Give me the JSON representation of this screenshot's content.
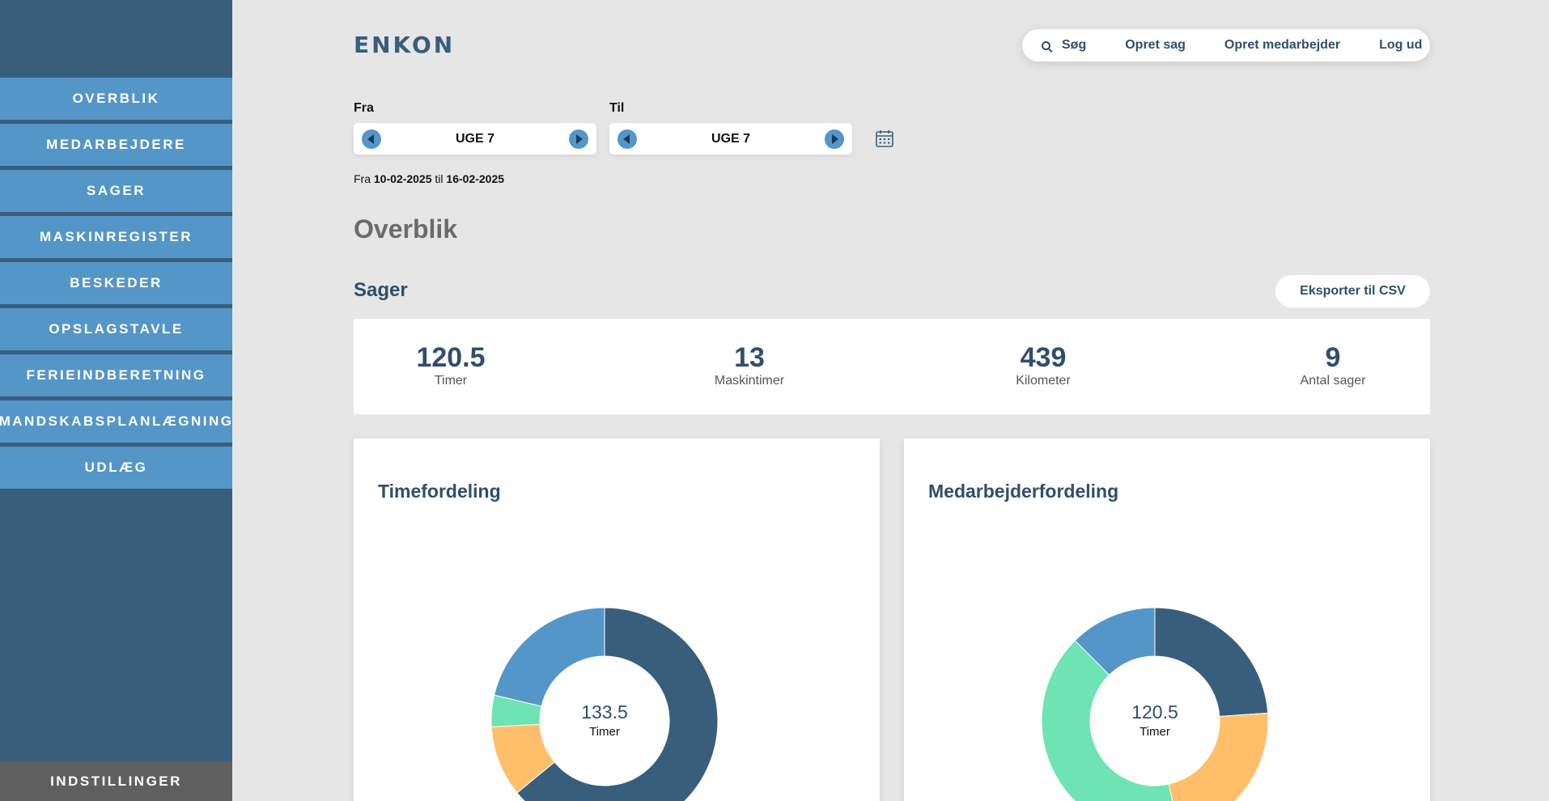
{
  "sidebar": {
    "items": [
      {
        "label": "OVERBLIK"
      },
      {
        "label": "MEDARBEJDERE"
      },
      {
        "label": "SAGER"
      },
      {
        "label": "MASKINREGISTER"
      },
      {
        "label": "BESKEDER"
      },
      {
        "label": "OPSLAGSTAVLE"
      },
      {
        "label": "FERIEINDBERETNING"
      },
      {
        "label": "MANDSKABSPLANLÆGNING"
      },
      {
        "label": "UDLÆG"
      }
    ],
    "settings_label": "INDSTILLINGER"
  },
  "header": {
    "logo_text": "ENKON",
    "nav": {
      "search": "Søg",
      "create_case": "Opret sag",
      "create_employee": "Opret medarbejder",
      "logout": "Log ud"
    }
  },
  "period": {
    "from_label": "Fra",
    "to_label": "Til",
    "from_week": "UGE 7",
    "to_week": "UGE 7",
    "range_prefix": "Fra",
    "range_start": "10-02-2025",
    "range_mid": "til",
    "range_end": "16-02-2025"
  },
  "page_title": "Overblik",
  "section": {
    "title": "Sager",
    "export_label": "Eksporter til CSV"
  },
  "stats": [
    {
      "value": "120.5",
      "label": "Timer"
    },
    {
      "value": "13",
      "label": "Maskintimer"
    },
    {
      "value": "439",
      "label": "Kilometer"
    },
    {
      "value": "9",
      "label": "Antal sager"
    }
  ],
  "colors": {
    "dark_blue": "#395e7c",
    "mid_blue": "#5496c8",
    "green": "#6ee3b3",
    "orange": "#ffbf6a"
  },
  "chart_data": [
    {
      "type": "pie",
      "title": "Timefordeling",
      "center_value": "133.5",
      "center_label": "Timer",
      "slices": [
        {
          "value": 85.5,
          "color": "#395e7c"
        },
        {
          "value": 13.5,
          "color": "#ffbf6a"
        },
        {
          "value": 6,
          "color": "#6ee3b3"
        },
        {
          "value": 28.5,
          "color": "#5496c8"
        }
      ]
    },
    {
      "type": "pie",
      "title": "Medarbejderfordeling",
      "center_value": "120.5",
      "center_label": "Timer",
      "slices": [
        {
          "value": 28.8,
          "color": "#395e7c"
        },
        {
          "value": 27.3,
          "color": "#ffbf6a"
        },
        {
          "value": 49.4,
          "color": "#6ee3b3"
        },
        {
          "value": 15.0,
          "color": "#5496c8"
        }
      ]
    }
  ]
}
